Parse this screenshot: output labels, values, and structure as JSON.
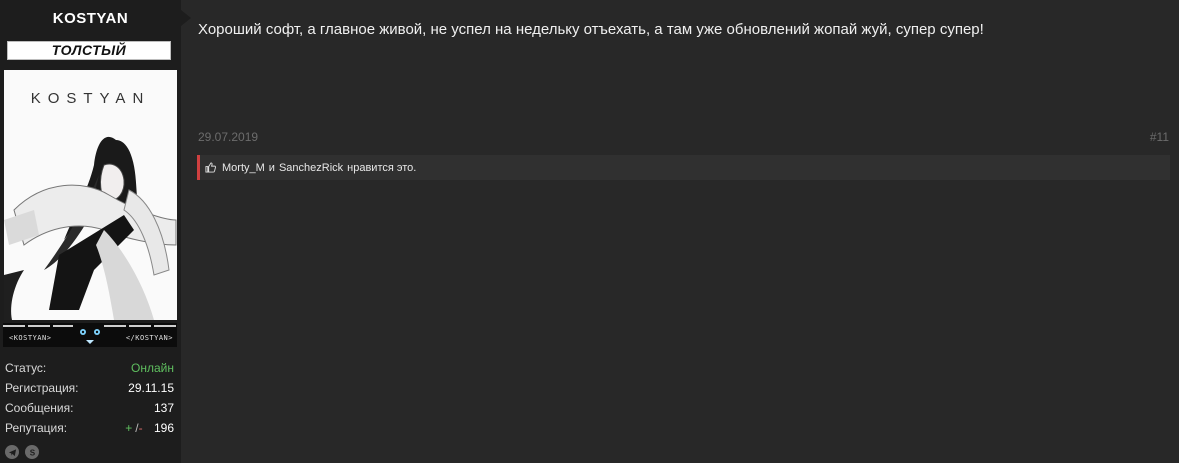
{
  "user": {
    "name": "KOSTYAN",
    "title": "ТОЛСТЫЙ",
    "avatar_text": "KOSTYAN",
    "banner_left": "<KOSTYAN>",
    "banner_right": "</KOSTYAN>",
    "stats": [
      {
        "label": "Статус:",
        "value": "Онлайн"
      },
      {
        "label": "Регистрация:",
        "value": "29.11.15"
      },
      {
        "label": "Сообщения:",
        "value": "137"
      },
      {
        "label": "Репутация:",
        "value": "196"
      }
    ],
    "rep_plus": "+",
    "rep_sep": "/",
    "rep_minus": "-",
    "social_icons": [
      "telegram-icon",
      "skype-icon"
    ]
  },
  "post": {
    "message": "Хороший софт, а главное живой, не успел на недельку отъехать, а там уже обновлений жопай жуй, супер супер!",
    "date": "29.07.2019",
    "number": "#11",
    "likes": {
      "user1": "Morty_M",
      "separator": "и",
      "user2": "SanchezRick",
      "suffix": "нравится это."
    }
  },
  "colors": {
    "page_bg": "#282828",
    "sidebar_bg": "#1d1d1d",
    "online": "#5fbf5f",
    "likes_accent": "#d04040"
  }
}
